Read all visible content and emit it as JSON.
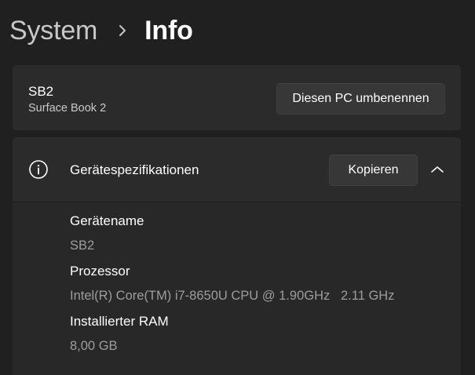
{
  "breadcrumb": {
    "parent": "System",
    "separator_icon": "chevron-right-icon",
    "current": "Info"
  },
  "device": {
    "name": "SB2",
    "model": "Surface Book 2",
    "rename_button": "Diesen PC umbenennen"
  },
  "specs": {
    "icon": "info-icon",
    "title": "Gerätespezifikationen",
    "copy_button": "Kopieren",
    "expanded": true,
    "items": [
      {
        "label": "Gerätename",
        "value": "SB2"
      },
      {
        "label": "Prozessor",
        "value": "Intel(R) Core(TM) i7-8650U CPU @ 1.90GHz   2.11 GHz"
      },
      {
        "label": "Installierter RAM",
        "value": "8,00 GB"
      }
    ]
  },
  "colors": {
    "background": "#202020",
    "card": "#2b2b2b",
    "button": "#373737",
    "text_primary": "#ffffff",
    "text_secondary": "#9d9d9d"
  }
}
